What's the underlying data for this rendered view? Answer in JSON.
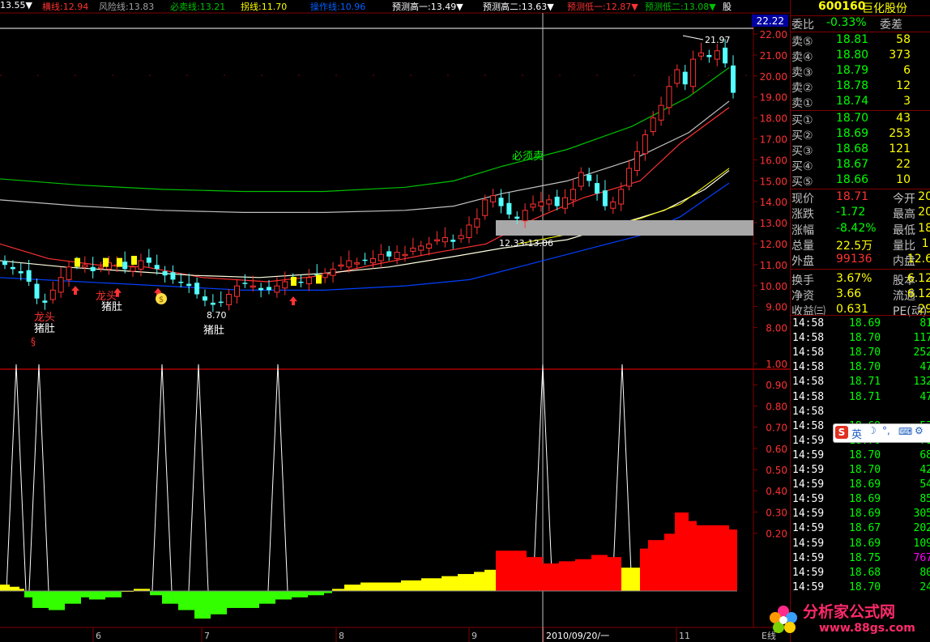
{
  "colors": {
    "up": "#ff3232",
    "down": "#54ffff",
    "ma_yellow": "#ffff00",
    "ma_blue": "#0000ff",
    "ma_green": "#00c000",
    "ma_white": "#ffffff",
    "bar_red": "#ff0000",
    "bar_yellow": "#ffff00",
    "bar_green": "#33ff00",
    "label_green": "#00ff00",
    "grid": "#800000"
  },
  "indicator_bar": [
    {
      "text": "13.55▼",
      "color": "#ffffff"
    },
    {
      "text": "横线:12.94",
      "color": "#ff3232"
    },
    {
      "text": "风险线:13.83",
      "color": "#a0a0a0"
    },
    {
      "text": "必卖线:13.21",
      "color": "#00c000"
    },
    {
      "text": "拐线:11.70",
      "color": "#ffff00"
    },
    {
      "text": "操作线:10.96",
      "color": "#0060ff"
    },
    {
      "text": "预测高一:13.49▼",
      "color": "#ffffff"
    },
    {
      "text": "预测高二:13.63▼",
      "color": "#ffffff"
    },
    {
      "text": "预测低一:12.87▼",
      "color": "#ff3232"
    },
    {
      "text": "预测低二:13.08▼",
      "color": "#00c000"
    },
    {
      "text": "股",
      "color": "#ffffff"
    }
  ],
  "current_price_tag": "22.22",
  "price_axis": [
    "22.00",
    "21.00",
    "20.00",
    "19.00",
    "18.00",
    "17.00",
    "16.00",
    "15.00",
    "14.00",
    "13.00",
    "12.00",
    "11.00",
    "10.00",
    "9.00",
    "8.00"
  ],
  "indicator_axis": [
    "1.00",
    "0.90",
    "0.80",
    "0.70",
    "0.60",
    "0.50",
    "0.40",
    "0.30",
    "0.20"
  ],
  "date_axis": [
    "6",
    "7",
    "8",
    "9",
    "2010/09/20/一",
    "11"
  ],
  "chart_annotations": {
    "peak_label": "21.97",
    "low_label": "8.70",
    "range_label": "12.33-13.06",
    "sell_label": "必须卖",
    "pattern_labels": [
      "龙头",
      "猪肚",
      "龙头",
      "猪肚",
      "猪肚"
    ],
    "dollar_mark": "$",
    "section_mark": "§"
  },
  "bottom_label": "E线",
  "quote": {
    "code": "600160",
    "name": "巨化股份",
    "weibi_label": "委比",
    "weibi_value": "-0.33%",
    "weicha_label": "委差",
    "sells": [
      {
        "label": "卖⑤",
        "price": "18.81",
        "vol": "58"
      },
      {
        "label": "卖④",
        "price": "18.80",
        "vol": "373"
      },
      {
        "label": "卖③",
        "price": "18.79",
        "vol": "6"
      },
      {
        "label": "卖②",
        "price": "18.78",
        "vol": "12"
      },
      {
        "label": "卖①",
        "price": "18.74",
        "vol": "3"
      }
    ],
    "buys": [
      {
        "label": "买①",
        "price": "18.70",
        "vol": "43"
      },
      {
        "label": "买②",
        "price": "18.69",
        "vol": "253"
      },
      {
        "label": "买③",
        "price": "18.68",
        "vol": "121"
      },
      {
        "label": "买④",
        "price": "18.67",
        "vol": "22"
      },
      {
        "label": "买⑤",
        "price": "18.66",
        "vol": "10"
      }
    ],
    "stats": [
      {
        "l1": "现价",
        "v1": "18.71",
        "c1": "#ff3232",
        "l2": "今开",
        "v2": "20"
      },
      {
        "l1": "涨跌",
        "v1": "-1.72",
        "c1": "#00ff00",
        "l2": "最高",
        "v2": "20"
      },
      {
        "l1": "涨幅",
        "v1": "-8.42%",
        "c1": "#00ff00",
        "l2": "最低",
        "v2": "18"
      },
      {
        "l1": "总量",
        "v1": "22.5万",
        "c1": "#ffff00",
        "l2": "量比",
        "v2": "1."
      },
      {
        "l1": "外盘",
        "v1": "99136",
        "c1": "#ff3232",
        "l2": "内盘",
        "v2": "12.6"
      },
      {
        "l1": "换手",
        "v1": "3.67%",
        "c1": "#ffff00",
        "l2": "股本",
        "v2": "6.12"
      },
      {
        "l1": "净资",
        "v1": "3.66",
        "c1": "#ffff00",
        "l2": "流通",
        "v2": "6.12"
      },
      {
        "l1": "收益㈢",
        "v1": "0.631",
        "c1": "#ffff00",
        "l2": "PE(动)",
        "v2": "29"
      }
    ],
    "ticks": [
      {
        "t": "14:58",
        "p": "18.69",
        "pc": "#00ff00",
        "v": "81",
        "vc": "#00ff00"
      },
      {
        "t": "14:58",
        "p": "18.70",
        "pc": "#00ff00",
        "v": "117",
        "vc": "#00ff00"
      },
      {
        "t": "14:58",
        "p": "18.70",
        "pc": "#00ff00",
        "v": "252",
        "vc": "#00ff00"
      },
      {
        "t": "14:58",
        "p": "18.70",
        "pc": "#00ff00",
        "v": "47",
        "vc": "#00ff00"
      },
      {
        "t": "14:58",
        "p": "18.71",
        "pc": "#00ff00",
        "v": "132",
        "vc": "#00ff00"
      },
      {
        "t": "14:58",
        "p": "18.71",
        "pc": "#00ff00",
        "v": "47",
        "vc": "#00ff00"
      },
      {
        "t": "14:58",
        "p": "",
        "pc": "#00ff00",
        "v": "",
        "vc": "#00ff00"
      },
      {
        "t": "14:58",
        "p": "18.69",
        "pc": "#00ff00",
        "v": "53",
        "vc": "#00ff00"
      },
      {
        "t": "14:59",
        "p": "18.70",
        "pc": "#00ff00",
        "v": "71",
        "vc": "#00ff00"
      },
      {
        "t": "14:59",
        "p": "18.70",
        "pc": "#00ff00",
        "v": "68",
        "vc": "#00ff00"
      },
      {
        "t": "14:59",
        "p": "18.70",
        "pc": "#00ff00",
        "v": "42",
        "vc": "#00ff00"
      },
      {
        "t": "14:59",
        "p": "18.69",
        "pc": "#00ff00",
        "v": "54",
        "vc": "#00ff00"
      },
      {
        "t": "14:59",
        "p": "18.69",
        "pc": "#00ff00",
        "v": "85",
        "vc": "#00ff00"
      },
      {
        "t": "14:59",
        "p": "18.69",
        "pc": "#00ff00",
        "v": "305",
        "vc": "#00ff00"
      },
      {
        "t": "14:59",
        "p": "18.67",
        "pc": "#00ff00",
        "v": "202",
        "vc": "#00ff00"
      },
      {
        "t": "14:59",
        "p": "18.69",
        "pc": "#00ff00",
        "v": "109",
        "vc": "#00ff00"
      },
      {
        "t": "14:59",
        "p": "18.75",
        "pc": "#00ff00",
        "v": "767",
        "vc": "#ff00ff"
      },
      {
        "t": "14:59",
        "p": "18.68",
        "pc": "#00ff00",
        "v": "80",
        "vc": "#00ff00"
      },
      {
        "t": "14:59",
        "p": "18.70",
        "pc": "#00ff00",
        "v": "24",
        "vc": "#00ff00"
      }
    ]
  },
  "ime_toolbar": {
    "logo": "S",
    "lang": "英"
  },
  "watermark": {
    "name": "分析家公式网",
    "url": "www.88gs.com"
  }
}
